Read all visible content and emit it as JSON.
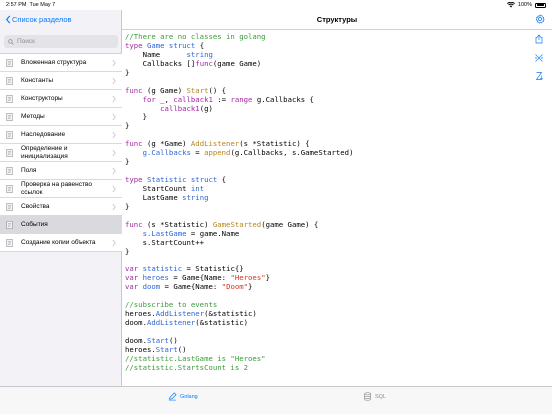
{
  "status_bar": {
    "time": "2:57 PM",
    "date": "Tue May 7",
    "battery": "100%"
  },
  "sidebar": {
    "back_label": "Список разделов",
    "search_placeholder": "Поиск",
    "items": [
      {
        "label": "Вложенная структура"
      },
      {
        "label": "Константы"
      },
      {
        "label": "Конструкторы"
      },
      {
        "label": "Методы"
      },
      {
        "label": "Наследование"
      },
      {
        "label": "Определение и инициализация"
      },
      {
        "label": "Поля"
      },
      {
        "label": "Проверка на равенство ссылок"
      },
      {
        "label": "Свойства"
      },
      {
        "label": "События",
        "selected": true
      },
      {
        "label": "Создание копии объекта"
      }
    ]
  },
  "detail": {
    "title": "Структуры",
    "code_lines": [
      [
        {
          "t": "//There are no classes in golang",
          "c": "cm"
        }
      ],
      [
        {
          "t": "type ",
          "c": "kw"
        },
        {
          "t": "Game struct ",
          "c": "ty"
        },
        {
          "t": "{",
          "c": ""
        }
      ],
      [
        {
          "t": "    Name      ",
          "c": ""
        },
        {
          "t": "string",
          "c": "ty"
        }
      ],
      [
        {
          "t": "    Callbacks []",
          "c": ""
        },
        {
          "t": "func",
          "c": "kw"
        },
        {
          "t": "(game Game)",
          "c": ""
        }
      ],
      [
        {
          "t": "}",
          "c": ""
        }
      ],
      [
        {
          "t": "",
          "c": ""
        }
      ],
      [
        {
          "t": "func ",
          "c": "kw"
        },
        {
          "t": "(g Game) ",
          "c": ""
        },
        {
          "t": "Start",
          "c": "fn"
        },
        {
          "t": "() {",
          "c": ""
        }
      ],
      [
        {
          "t": "    ",
          "c": ""
        },
        {
          "t": "for ",
          "c": "kw"
        },
        {
          "t": "_, ",
          "c": ""
        },
        {
          "t": "callback1 ",
          "c": "kw"
        },
        {
          "t": ":= ",
          "c": ""
        },
        {
          "t": "range ",
          "c": "kw"
        },
        {
          "t": "g.Callbacks {",
          "c": ""
        }
      ],
      [
        {
          "t": "        ",
          "c": ""
        },
        {
          "t": "callback1",
          "c": "kw"
        },
        {
          "t": "(g)",
          "c": ""
        }
      ],
      [
        {
          "t": "    }",
          "c": ""
        }
      ],
      [
        {
          "t": "}",
          "c": ""
        }
      ],
      [
        {
          "t": "",
          "c": ""
        }
      ],
      [
        {
          "t": "func ",
          "c": "kw"
        },
        {
          "t": "(g *Game) ",
          "c": ""
        },
        {
          "t": "AddListener",
          "c": "fn"
        },
        {
          "t": "(s *Statistic) {",
          "c": ""
        }
      ],
      [
        {
          "t": "    ",
          "c": ""
        },
        {
          "t": "g.Callbacks ",
          "c": "ty"
        },
        {
          "t": "= ",
          "c": ""
        },
        {
          "t": "append",
          "c": "fn"
        },
        {
          "t": "(g.Callbacks, s.GameStarted)",
          "c": ""
        }
      ],
      [
        {
          "t": "}",
          "c": ""
        }
      ],
      [
        {
          "t": "",
          "c": ""
        }
      ],
      [
        {
          "t": "type ",
          "c": "kw"
        },
        {
          "t": "Statistic struct ",
          "c": "ty"
        },
        {
          "t": "{",
          "c": ""
        }
      ],
      [
        {
          "t": "    StartCount ",
          "c": ""
        },
        {
          "t": "int",
          "c": "ty"
        }
      ],
      [
        {
          "t": "    LastGame ",
          "c": ""
        },
        {
          "t": "string",
          "c": "ty"
        }
      ],
      [
        {
          "t": "}",
          "c": ""
        }
      ],
      [
        {
          "t": "",
          "c": ""
        }
      ],
      [
        {
          "t": "func ",
          "c": "kw"
        },
        {
          "t": "(s *Statistic) ",
          "c": ""
        },
        {
          "t": "GameStarted",
          "c": "fn"
        },
        {
          "t": "(game Game) {",
          "c": ""
        }
      ],
      [
        {
          "t": "    ",
          "c": ""
        },
        {
          "t": "s.LastGame ",
          "c": "ty"
        },
        {
          "t": "= game.Name",
          "c": ""
        }
      ],
      [
        {
          "t": "    s.StartCount++",
          "c": ""
        }
      ],
      [
        {
          "t": "}",
          "c": ""
        }
      ],
      [
        {
          "t": "",
          "c": ""
        }
      ],
      [
        {
          "t": "var ",
          "c": "kw"
        },
        {
          "t": "statistic ",
          "c": "ty"
        },
        {
          "t": "= Statistic{}",
          "c": ""
        }
      ],
      [
        {
          "t": "var ",
          "c": "kw"
        },
        {
          "t": "heroes ",
          "c": "ty"
        },
        {
          "t": "= Game{Name: ",
          "c": ""
        },
        {
          "t": "\"Heroes\"",
          "c": "st"
        },
        {
          "t": "}",
          "c": ""
        }
      ],
      [
        {
          "t": "var ",
          "c": "kw"
        },
        {
          "t": "doom ",
          "c": "ty"
        },
        {
          "t": "= Game{Name: ",
          "c": ""
        },
        {
          "t": "\"Doom\"",
          "c": "st"
        },
        {
          "t": "}",
          "c": ""
        }
      ],
      [
        {
          "t": "",
          "c": ""
        }
      ],
      [
        {
          "t": "//subscribe to events",
          "c": "cm"
        }
      ],
      [
        {
          "t": "heroes.",
          "c": ""
        },
        {
          "t": "AddListener",
          "c": "ty"
        },
        {
          "t": "(&statistic)",
          "c": ""
        }
      ],
      [
        {
          "t": "doom.",
          "c": ""
        },
        {
          "t": "AddListener",
          "c": "ty"
        },
        {
          "t": "(&statistic)",
          "c": ""
        }
      ],
      [
        {
          "t": "",
          "c": ""
        }
      ],
      [
        {
          "t": "doom.",
          "c": ""
        },
        {
          "t": "Start",
          "c": "ty"
        },
        {
          "t": "()",
          "c": ""
        }
      ],
      [
        {
          "t": "heroes.",
          "c": ""
        },
        {
          "t": "Start",
          "c": "ty"
        },
        {
          "t": "()",
          "c": ""
        }
      ],
      [
        {
          "t": "//statistic.LastGame is \"Heroes\"",
          "c": "cm"
        }
      ],
      [
        {
          "t": "//statistic.StartsCount is 2",
          "c": "cm"
        }
      ]
    ]
  },
  "tabs": [
    {
      "label": "Golang",
      "active": true
    },
    {
      "label": "SQL",
      "active": false
    }
  ],
  "colors": {
    "accent": "#0a7aff"
  }
}
